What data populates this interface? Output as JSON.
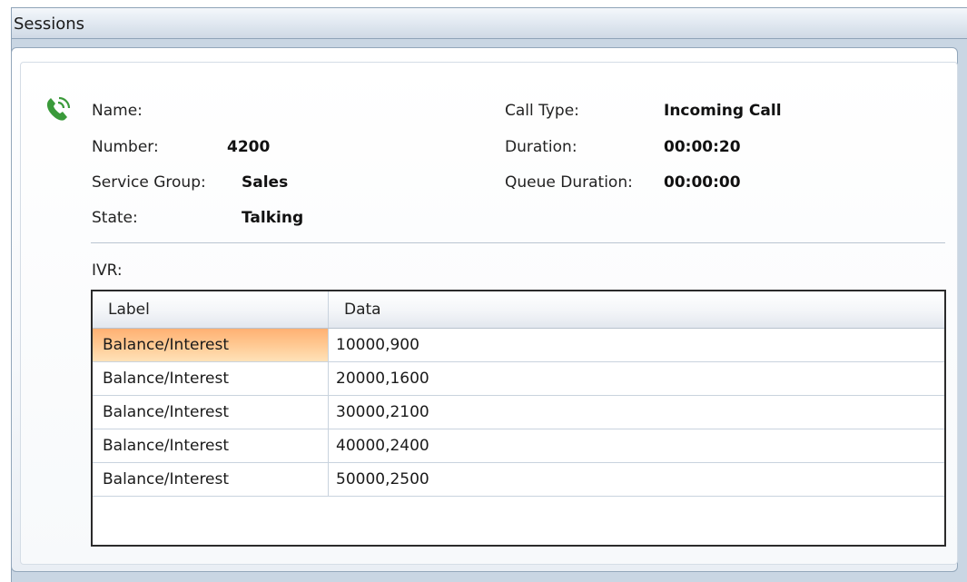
{
  "panel": {
    "title": "Sessions"
  },
  "session": {
    "icon": "phone-call-icon",
    "fields_left": [
      {
        "label": "Name:",
        "value": ""
      },
      {
        "label": "Number:",
        "value": "4200"
      },
      {
        "label": "Service Group:",
        "value": "Sales"
      },
      {
        "label": "State:",
        "value": "Talking"
      }
    ],
    "fields_right": [
      {
        "label": "Call Type:",
        "value": "Incoming Call"
      },
      {
        "label": "Duration:",
        "value": "00:00:20"
      },
      {
        "label": "Queue Duration:",
        "value": "00:00:00"
      }
    ]
  },
  "ivr": {
    "label": "IVR:",
    "columns": [
      "Label",
      "Data"
    ],
    "rows": [
      {
        "label": "Balance/Interest",
        "data": "10000,900"
      },
      {
        "label": "Balance/Interest",
        "data": "20000,1600"
      },
      {
        "label": "Balance/Interest",
        "data": "30000,2100"
      },
      {
        "label": "Balance/Interest",
        "data": "40000,2400"
      },
      {
        "label": "Balance/Interest",
        "data": "50000,2500"
      }
    ],
    "selected_row": 0
  },
  "colors": {
    "accent_green": "#3a9a3a",
    "selection": "#ffb173"
  }
}
